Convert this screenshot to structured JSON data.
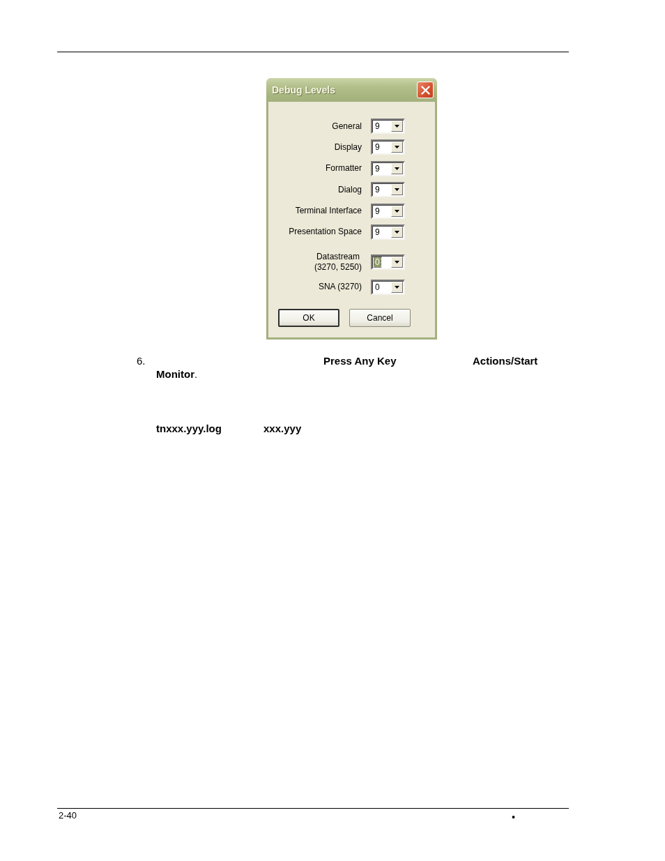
{
  "dialog": {
    "title": "Debug Levels",
    "groups": [
      {
        "fields": [
          {
            "label": "General",
            "value": "9",
            "focused": false
          },
          {
            "label": "Display",
            "value": "9",
            "focused": false
          },
          {
            "label": "Formatter",
            "value": "9",
            "focused": false
          },
          {
            "label": "Dialog",
            "value": "9",
            "focused": false
          },
          {
            "label": "Terminal Interface",
            "value": "9",
            "focused": false
          },
          {
            "label": "Presentation Space",
            "value": "9",
            "focused": false
          }
        ]
      },
      {
        "fields": [
          {
            "label": "Datastream\n(3270, 5250)",
            "value": "0",
            "focused": true
          },
          {
            "label": "SNA (3270)",
            "value": "0",
            "focused": false
          }
        ]
      }
    ],
    "buttons": [
      {
        "label": "OK",
        "default": true
      },
      {
        "label": "Cancel",
        "default": false
      }
    ]
  },
  "step": {
    "number": "6.",
    "lines": [
      {
        "segments": [
          {
            "text": "Press Any Key",
            "kind": "term"
          },
          {
            "text": "Actions/Start",
            "kind": "term"
          }
        ]
      },
      {
        "segments": [
          {
            "text": "**Monitor**.",
            "kind": "text"
          }
        ]
      },
      {
        "segments": [
          {
            "text": "tnxxx.yyy.log",
            "kind": "term"
          },
          {
            "text": "xxx.yyy",
            "kind": "term"
          }
        ]
      }
    ]
  },
  "footer": {
    "page_number": "2-40",
    "mark": "•"
  }
}
